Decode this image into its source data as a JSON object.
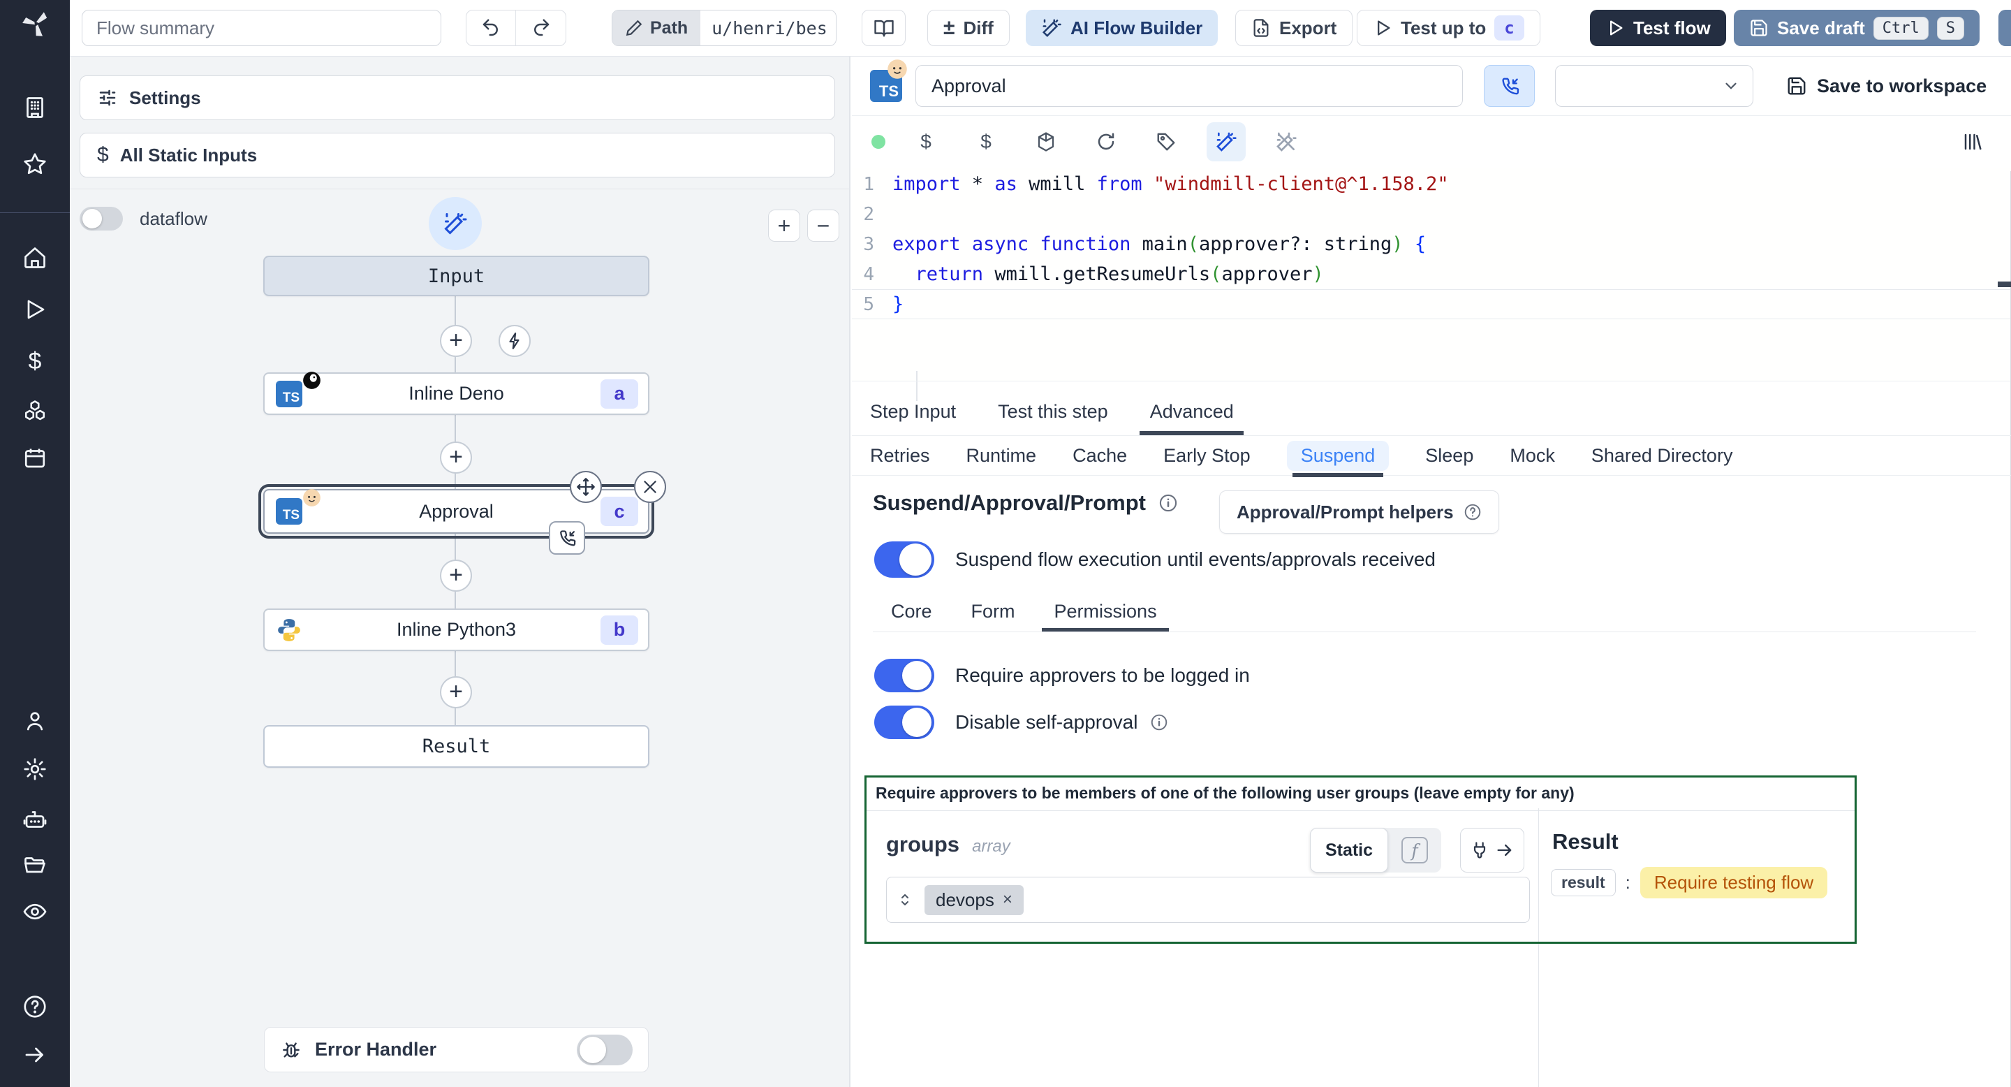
{
  "colors": {
    "toggle_on": "#3c66ee",
    "ai_button_bg": "#d8e7f8",
    "ai_button_text": "#1e3a6e",
    "save_draft_bg": "#6884a8",
    "test_flow_bg": "#242e41",
    "badge_bg": "#e0e7ff",
    "badge_text": "#4338ca",
    "suspend_tab_text": "#3b82f6",
    "group_box_border": "#166534",
    "result_value_bg": "#fbf0a8",
    "result_value_text": "#b45309",
    "ts_badge_bg": "#3178c6"
  },
  "topbar": {
    "flow_summary_placeholder": "Flow summary",
    "path_label": "Path",
    "path_value": "u/henri/bes",
    "diff_symbol": "±",
    "diff_label": "Diff",
    "ai_flow_builder_label": "AI Flow Builder",
    "export_label": "Export",
    "test_up_to_label": "Test up to",
    "test_up_to_badge": "c",
    "test_flow_label": "Test flow",
    "save_draft_label": "Save draft",
    "save_draft_kbd_1": "Ctrl",
    "save_draft_kbd_2": "S"
  },
  "sidebar": {
    "icons": [
      "windmill-logo",
      "building",
      "star",
      "home",
      "play",
      "dollar",
      "cubes",
      "calendar",
      "user",
      "gear",
      "robot",
      "folder",
      "eye",
      "help",
      "arrow-right"
    ]
  },
  "left_panel": {
    "settings_label": "Settings",
    "all_static_inputs_label": "All Static Inputs",
    "dataflow_label": "dataflow",
    "zoom_in_label": "+",
    "zoom_out_label": "−",
    "error_handler_label": "Error Handler"
  },
  "graph": {
    "nodes": [
      {
        "label": "Input"
      },
      {
        "label": "Inline Deno",
        "badge": "a"
      },
      {
        "label": "Approval",
        "badge": "c"
      },
      {
        "label": "Inline Python3",
        "badge": "b"
      },
      {
        "label": "Result"
      }
    ]
  },
  "step_editor": {
    "name_value": "Approval",
    "save_to_workspace_label": "Save to workspace",
    "toolbar_icons": [
      "status-dot",
      "variable-picker",
      "resource-picker",
      "dependencies",
      "reset",
      "tag",
      "ai-assistant",
      "ai-diff",
      "library"
    ],
    "code": [
      [
        {
          "t": "import",
          "c": "kw"
        },
        {
          "t": " * ",
          "c": "pl"
        },
        {
          "t": "as",
          "c": "kw"
        },
        {
          "t": " wmill ",
          "c": "pl"
        },
        {
          "t": "from",
          "c": "kw"
        },
        {
          "t": " ",
          "c": "pl"
        },
        {
          "t": "\"windmill-client@^1.158.2\"",
          "c": "str"
        }
      ],
      [],
      [
        {
          "t": "export",
          "c": "kw"
        },
        {
          "t": " ",
          "c": "pl"
        },
        {
          "t": "async",
          "c": "kw"
        },
        {
          "t": " ",
          "c": "pl"
        },
        {
          "t": "function",
          "c": "kw"
        },
        {
          "t": " main",
          "c": "pl"
        },
        {
          "t": "(",
          "c": "paren"
        },
        {
          "t": "approver?: string",
          "c": "pl"
        },
        {
          "t": ")",
          "c": "paren"
        },
        {
          "t": " ",
          "c": "pl"
        },
        {
          "t": "{",
          "c": "brace"
        }
      ],
      [
        {
          "t": "  ",
          "c": "pl"
        },
        {
          "t": "return",
          "c": "kw"
        },
        {
          "t": " wmill.getResumeUrls",
          "c": "pl"
        },
        {
          "t": "(",
          "c": "paren"
        },
        {
          "t": "approver",
          "c": "pl"
        },
        {
          "t": ")",
          "c": "paren"
        }
      ],
      [
        {
          "t": "}",
          "c": "brace"
        }
      ]
    ],
    "tabs": [
      "Step Input",
      "Test this step",
      "Advanced"
    ],
    "active_tab": "Advanced",
    "subtabs": [
      "Retries",
      "Runtime",
      "Cache",
      "Early Stop",
      "Suspend",
      "Sleep",
      "Mock",
      "Shared Directory"
    ],
    "active_subtab": "Suspend"
  },
  "suspend": {
    "title": "Suspend/Approval/Prompt",
    "helpers_button_label": "Approval/Prompt helpers",
    "suspend_toggle_label": "Suspend flow execution until events/approvals received",
    "tabs": [
      "Core",
      "Form",
      "Permissions"
    ],
    "active_tab": "Permissions",
    "require_logged_in_label": "Require approvers to be logged in",
    "disable_self_approval_label": "Disable self-approval",
    "groups_box": {
      "title": "Require approvers to be members of one of the following user groups (leave empty for any)",
      "field_name": "groups",
      "field_type": "array",
      "static_label": "Static",
      "tags": [
        "devops"
      ]
    }
  },
  "result_panel": {
    "title": "Result",
    "key": "result",
    "value": "Require testing flow"
  }
}
